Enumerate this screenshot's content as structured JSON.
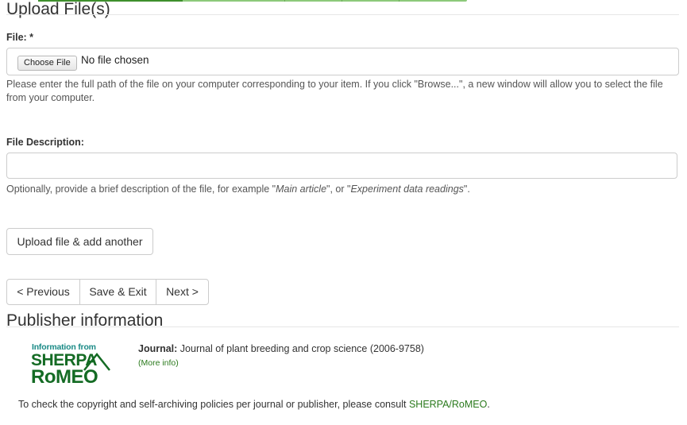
{
  "upload": {
    "title": "Upload File(s)",
    "file_label": "File: *",
    "choose_button": "Choose File",
    "file_status": "No file chosen",
    "file_help": "Please enter the full path of the file on your computer corresponding to your item. If you click \"Browse...\", a new window will allow you to select the file from your computer.",
    "description_label": "File Description:",
    "description_value": "",
    "description_help_prefix": "Optionally, provide a brief description of the file, for example \"",
    "description_help_example1": "Main article",
    "description_help_mid": "\", or \"",
    "description_help_example2": "Experiment data readings",
    "description_help_suffix": "\".",
    "upload_another_button": "Upload file & add another"
  },
  "navigation": {
    "previous": "< Previous",
    "save_exit": "Save & Exit",
    "next": "Next >"
  },
  "publisher": {
    "title": "Publisher information",
    "logo": {
      "line1": "Information from",
      "line2": "SHERPA",
      "line3": "RoMEO"
    },
    "journal_label": "Journal:",
    "journal_value": "Journal of plant breeding and crop science (2006-9758)",
    "more_info": "(More info)",
    "consult_text": "To check the copyright and self-archiving policies per journal or publisher, please consult",
    "consult_link": "SHERPA/RoMEO",
    "consult_end": "."
  },
  "colors": {
    "progress_done": "#3e8f2c",
    "progress_todo": "#8cc97a",
    "link_green": "#2b7a1d",
    "logo_green": "#146b24",
    "logo_teal": "#1a8a86"
  }
}
